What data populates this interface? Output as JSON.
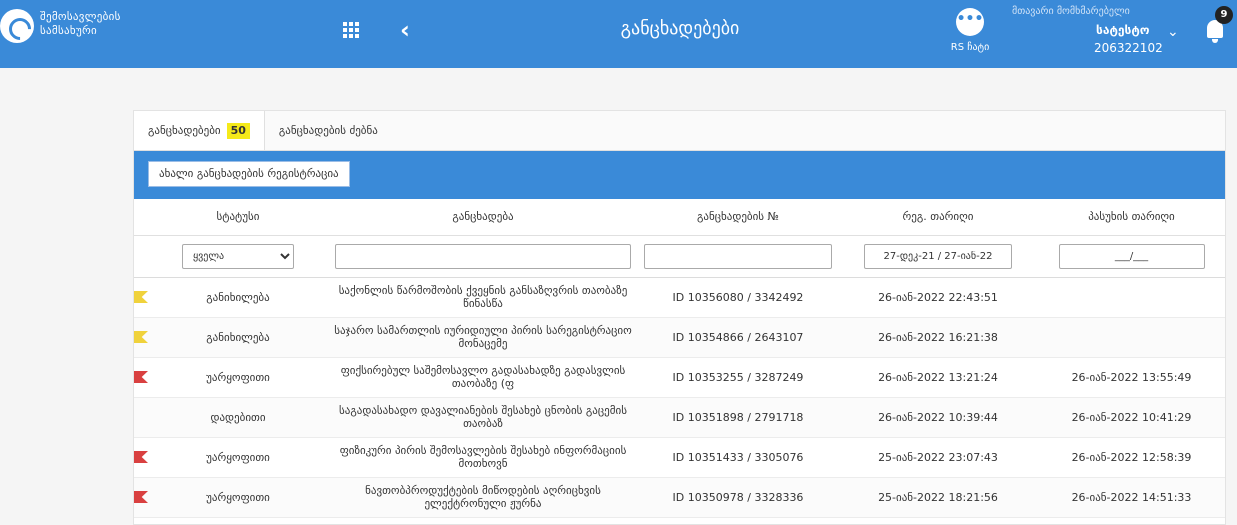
{
  "header": {
    "brand_line1": "შემოსავლების",
    "brand_line2": "სამსახური",
    "page_title": "განცხადებები",
    "chat_label": "RS ჩატი",
    "user_role": "მთავარი მომხმარებელი",
    "user_name": "სატესტო",
    "user_id": "206322102",
    "notification_count": "9"
  },
  "tabs": [
    {
      "label": "განცხადებები",
      "count": "50"
    },
    {
      "label": "განცხადების ძებნა"
    }
  ],
  "toolbar": {
    "register_label": "ახალი განცხადების რეგისტრაცია"
  },
  "columns": [
    "სტატუსი",
    "განცხადება",
    "განცხადების №",
    "რეგ. თარიღი",
    "პასუხის თარიღი"
  ],
  "filters": {
    "status_selected": "ყველა",
    "application": "",
    "number": "",
    "reg_date_range": "27-დეკ-21 / 27-იან-22",
    "answer_date": "___/___"
  },
  "colors": {
    "topbar": "#3a8ad8",
    "flag_yellow": "#f0d23c",
    "flag_red": "#d94040",
    "count_badge": "#f5ea1a"
  },
  "rows": [
    {
      "flag": "#f0d23c",
      "status": "განიხილება",
      "application": "საქონლის წარმოშობის ქვეყნის განსაზღვრის თაობაზე წინასწა",
      "number": "ID 10356080 / 3342492",
      "reg_date": "26-იან-2022 22:43:51",
      "answer_date": ""
    },
    {
      "flag": "#f0d23c",
      "status": "განიხილება",
      "application": "საჯარო სამართლის იურიდიული პირის სარეგისტრაციო მონაცემე",
      "number": "ID 10354866 / 2643107",
      "reg_date": "26-იან-2022 16:21:38",
      "answer_date": ""
    },
    {
      "flag": "#d94040",
      "status": "უარყოფითი",
      "application": "ფიქსირებულ საშემოსავლო გადასახადზე გადასვლის თაობაზე (ფ",
      "number": "ID 10353255 / 3287249",
      "reg_date": "26-იან-2022 13:21:24",
      "answer_date": "26-იან-2022 13:55:49"
    },
    {
      "flag": "",
      "status": "დადებითი",
      "application": "საგადასახადო დავალიანების შესახებ ცნობის გაცემის თაობაზ",
      "number": "ID 10351898 / 2791718",
      "reg_date": "26-იან-2022 10:39:44",
      "answer_date": "26-იან-2022 10:41:29"
    },
    {
      "flag": "#d94040",
      "status": "უარყოფითი",
      "application": "ფიზიკური პირის შემოსავლების შესახებ ინფორმაციის მოთხოვნ",
      "number": "ID 10351433 / 3305076",
      "reg_date": "25-იან-2022 23:07:43",
      "answer_date": "26-იან-2022 12:58:39"
    },
    {
      "flag": "#d94040",
      "status": "უარყოფითი",
      "application": "ნავთობპროდუქტების მიწოდების აღრიცხვის ელექტრონული ჟურნა",
      "number": "ID 10350978 / 3328336",
      "reg_date": "25-იან-2022 18:21:56",
      "answer_date": "26-იან-2022 14:51:33"
    }
  ]
}
